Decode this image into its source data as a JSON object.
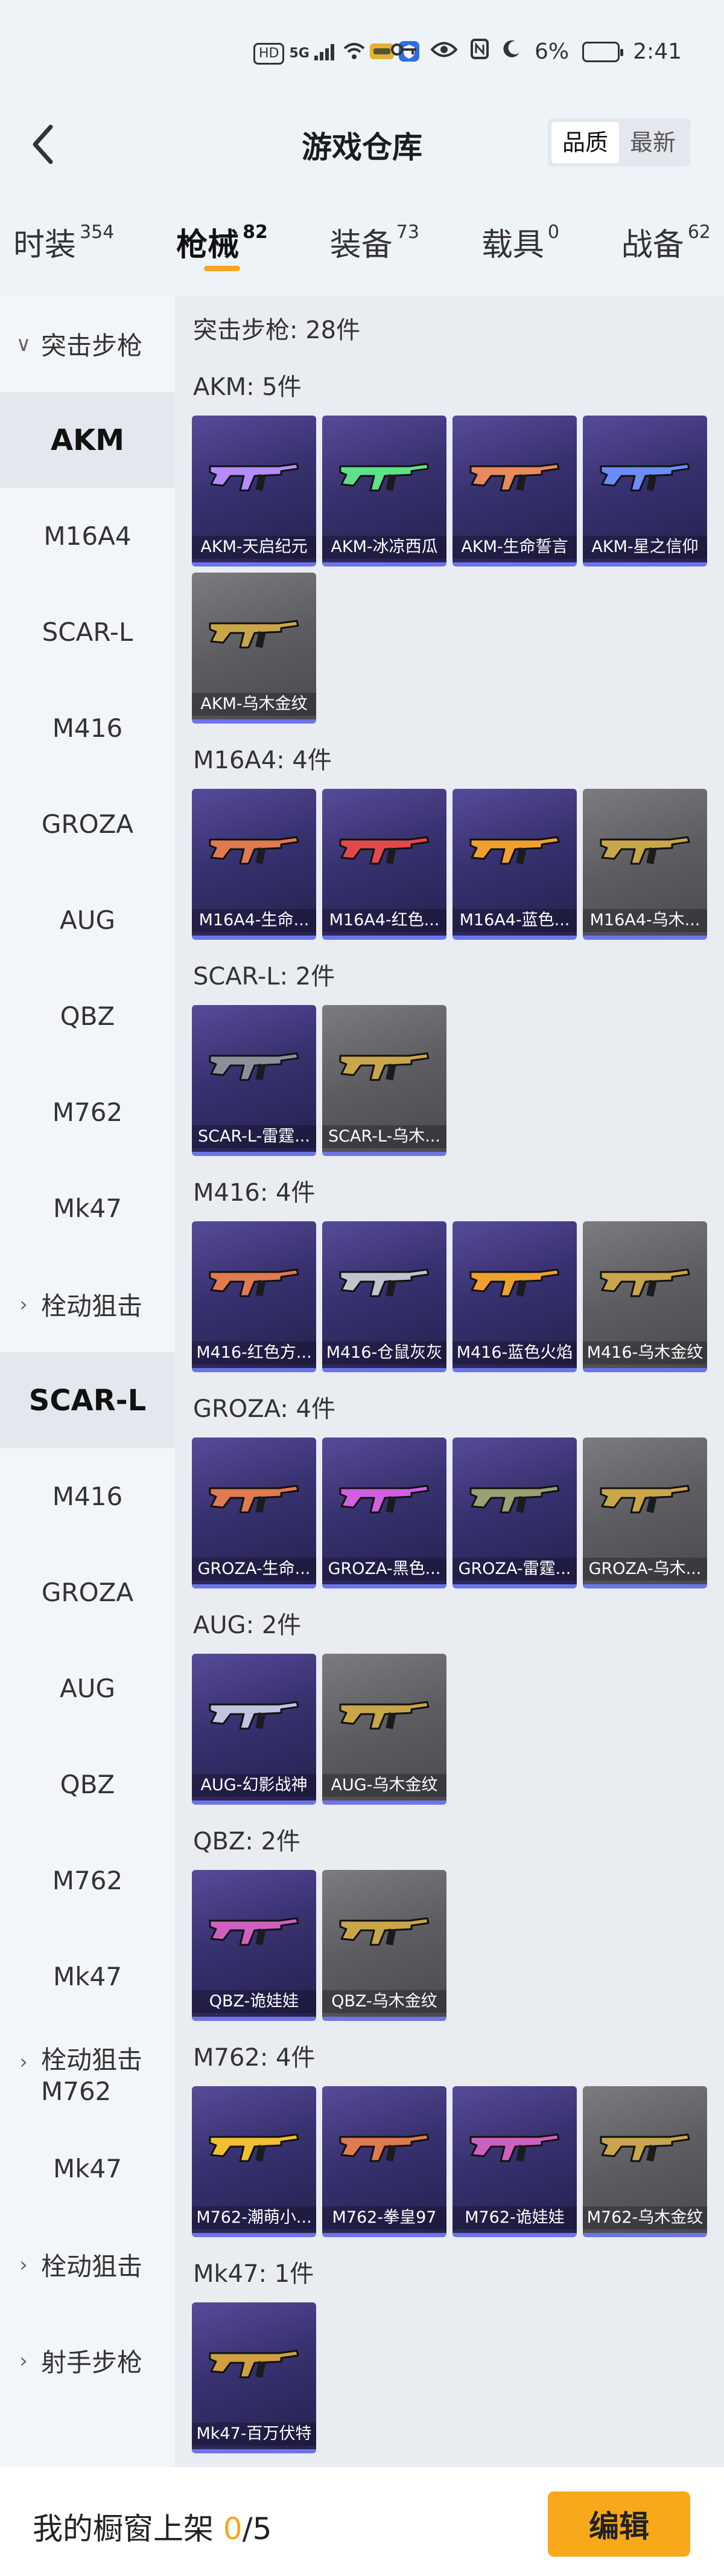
{
  "status_bar": {
    "left_chips": [
      "HD",
      "5G"
    ],
    "battery_percent": "6%",
    "time": "2:41"
  },
  "header": {
    "title": "游戏仓库",
    "sort_options": [
      "品质",
      "最新"
    ],
    "sort_selected": "品质"
  },
  "tabs": [
    {
      "label": "时装",
      "count": "354"
    },
    {
      "label": "枪械",
      "count": "82"
    },
    {
      "label": "装备",
      "count": "73"
    },
    {
      "label": "载具",
      "count": "0"
    },
    {
      "label": "战备",
      "count": "62"
    }
  ],
  "sidebar": {
    "items": [
      {
        "label": "突击步枪",
        "type": "group",
        "chevron": "∨"
      },
      {
        "label": "AKM",
        "type": "selected"
      },
      {
        "label": "M16A4",
        "type": "item"
      },
      {
        "label": "SCAR-L",
        "type": "item"
      },
      {
        "label": "M416",
        "type": "item"
      },
      {
        "label": "GROZA",
        "type": "item"
      },
      {
        "label": "AUG",
        "type": "item"
      },
      {
        "label": "QBZ",
        "type": "item"
      },
      {
        "label": "M762",
        "type": "item"
      },
      {
        "label": "Mk47",
        "type": "item"
      },
      {
        "label": "栓动狙击",
        "type": "group",
        "chevron": "›"
      },
      {
        "label": "SCAR-L",
        "type": "selected"
      },
      {
        "label": "M416",
        "type": "item"
      },
      {
        "label": "GROZA",
        "type": "item"
      },
      {
        "label": "AUG",
        "type": "item"
      },
      {
        "label": "QBZ",
        "type": "item"
      },
      {
        "label": "M762",
        "type": "item"
      },
      {
        "label": "Mk47",
        "type": "item"
      },
      {
        "label": "栓动狙击",
        "label2": "M762",
        "type": "multi",
        "chevron": "›"
      },
      {
        "label": "Mk47",
        "type": "item"
      },
      {
        "label": "栓动狙击",
        "type": "group",
        "chevron": "›"
      },
      {
        "label": "射手步枪",
        "type": "group",
        "chevron": "›"
      }
    ]
  },
  "main": {
    "heading": "突击步枪: 28件",
    "groups": [
      {
        "label": "AKM: 5件",
        "items": [
          {
            "name": "AKM-天启纪元",
            "bg": "purple",
            "color": "#b48cff"
          },
          {
            "name": "AKM-冰凉西瓜",
            "bg": "purple",
            "color": "#5fe08a"
          },
          {
            "name": "AKM-生命誓言",
            "bg": "purple",
            "color": "#e88a5c"
          },
          {
            "name": "AKM-星之信仰",
            "bg": "purple",
            "color": "#6a8cff"
          },
          {
            "name": "AKM-乌木金纹",
            "bg": "gray",
            "color": "#c9a64a"
          }
        ]
      },
      {
        "label": "M16A4: 4件",
        "items": [
          {
            "name": "M16A4-生命...",
            "bg": "purple",
            "color": "#e07a50"
          },
          {
            "name": "M16A4-红色...",
            "bg": "purple",
            "color": "#e04a4a"
          },
          {
            "name": "M16A4-蓝色...",
            "bg": "purple",
            "color": "#f0a030"
          },
          {
            "name": "M16A4-乌木...",
            "bg": "gray",
            "color": "#c9a64a"
          }
        ]
      },
      {
        "label": "SCAR-L: 2件",
        "items": [
          {
            "name": "SCAR-L-雷霆...",
            "bg": "purple",
            "color": "#8a8f99"
          },
          {
            "name": "SCAR-L-乌木...",
            "bg": "gray",
            "color": "#c9a64a"
          }
        ]
      },
      {
        "label": "M416: 4件",
        "items": [
          {
            "name": "M416-红色方...",
            "bg": "purple",
            "color": "#e07a50"
          },
          {
            "name": "M416-仓鼠灰灰",
            "bg": "purple",
            "color": "#c0c4cc"
          },
          {
            "name": "M416-蓝色火焰",
            "bg": "purple",
            "color": "#f0a030"
          },
          {
            "name": "M416-乌木金纹",
            "bg": "gray",
            "color": "#c9a64a"
          }
        ]
      },
      {
        "label": "GROZA: 4件",
        "items": [
          {
            "name": "GROZA-生命...",
            "bg": "purple",
            "color": "#e07a50"
          },
          {
            "name": "GROZA-黑色...",
            "bg": "purple",
            "color": "#d060e0"
          },
          {
            "name": "GROZA-雷霆...",
            "bg": "purple",
            "color": "#9aa070"
          },
          {
            "name": "GROZA-乌木...",
            "bg": "gray",
            "color": "#c9a64a"
          }
        ]
      },
      {
        "label": "AUG: 2件",
        "items": [
          {
            "name": "AUG-幻影战神",
            "bg": "purple",
            "color": "#c0c4e0"
          },
          {
            "name": "AUG-乌木金纹",
            "bg": "gray",
            "color": "#c9a64a"
          }
        ]
      },
      {
        "label": "QBZ: 2件",
        "items": [
          {
            "name": "QBZ-诡娃娃",
            "bg": "purple",
            "color": "#d060c0"
          },
          {
            "name": "QBZ-乌木金纹",
            "bg": "gray",
            "color": "#c9a64a"
          }
        ]
      },
      {
        "label": "M762: 4件",
        "items": [
          {
            "name": "M762-潮萌小...",
            "bg": "purple",
            "color": "#f0c030"
          },
          {
            "name": "M762-拳皇97",
            "bg": "purple",
            "color": "#e07a50"
          },
          {
            "name": "M762-诡娃娃",
            "bg": "purple",
            "color": "#d060c0"
          },
          {
            "name": "M762-乌木金纹",
            "bg": "gray",
            "color": "#c9a64a"
          }
        ]
      },
      {
        "label": "Mk47: 1件",
        "items": [
          {
            "name": "Mk47-百万伏特",
            "bg": "purple",
            "color": "#d0a040"
          }
        ]
      }
    ]
  },
  "bottom_bar": {
    "shelf_label": "我的橱窗上架",
    "shelf_count": "0",
    "shelf_total": "/5",
    "edit_label": "编辑"
  },
  "colors": {
    "accent": "#f5a623",
    "card_underline": "#6d74e8"
  }
}
